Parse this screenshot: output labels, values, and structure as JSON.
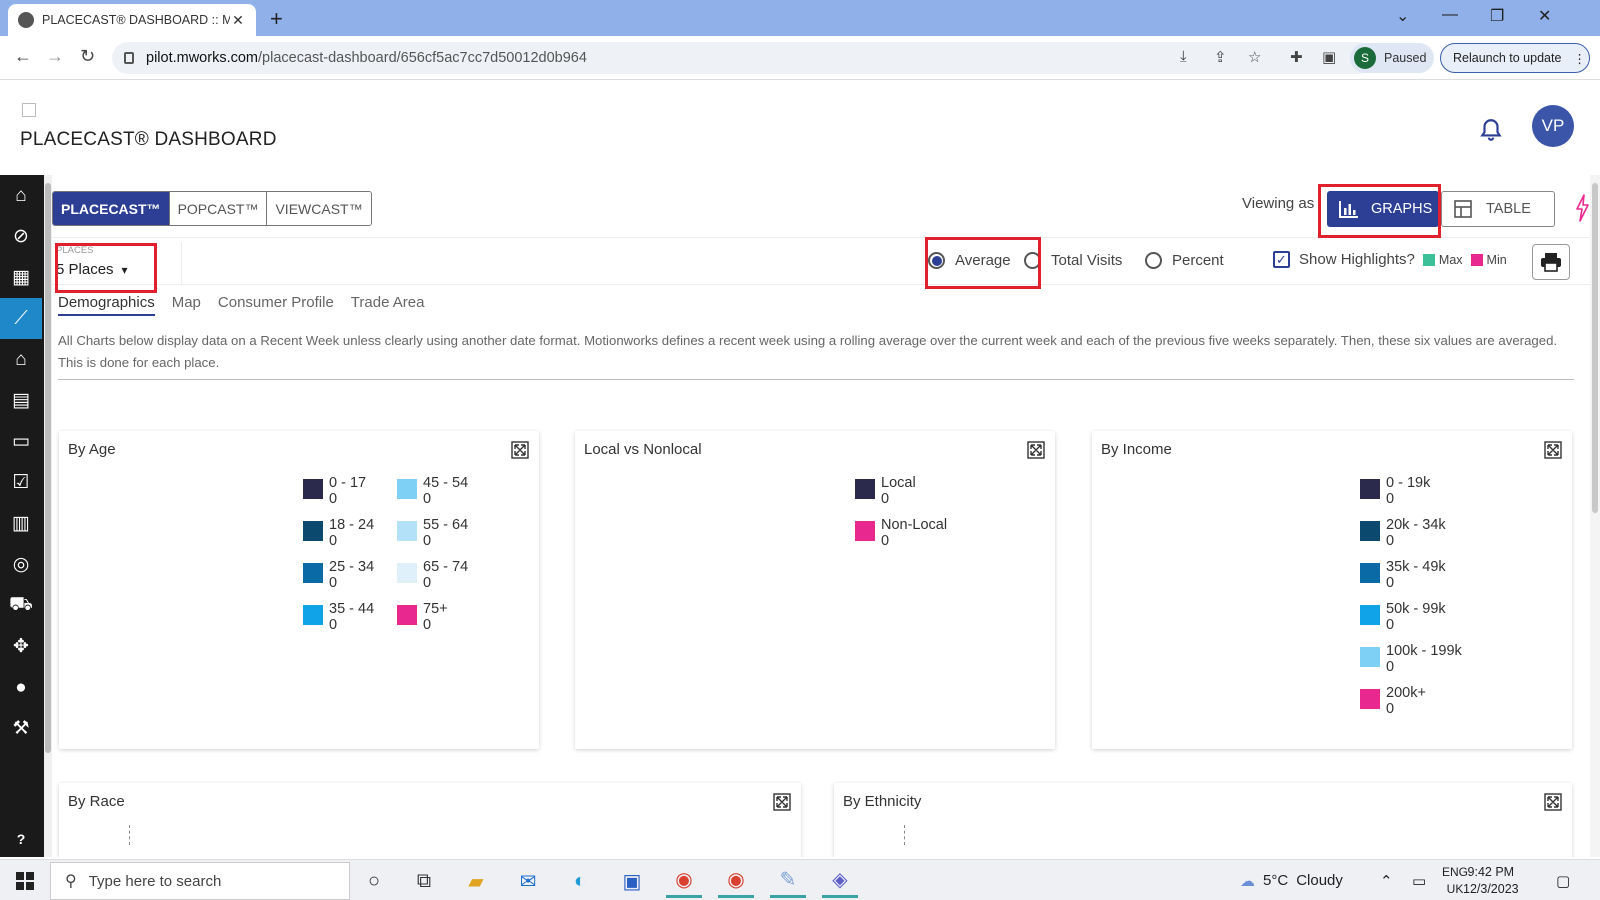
{
  "browser": {
    "tab_title": "PLACECAST® DASHBOARD :: M",
    "tab_close": "✕",
    "new_tab": "+",
    "url_domain": "pilot.mworks.com",
    "url_path": "/placecast-dashboard/656cf5ac7cc7d50012d0b964",
    "profile_initial": "S",
    "profile_status": "Paused",
    "relaunch_label": "Relaunch to update"
  },
  "header": {
    "title": "PLACECAST® DASHBOARD",
    "avatar_initials": "VP"
  },
  "product_tabs": [
    "PLACECAST™",
    "POPCAST™",
    "VIEWCAST™"
  ],
  "view_mode": {
    "viewing_label": "Viewing as",
    "graphs_label": "GRAPHS",
    "table_label": "TABLE"
  },
  "filters": {
    "places_label": "PLACES",
    "places_value": "5 Places",
    "metric_options": [
      "Average",
      "Total Visits",
      "Percent"
    ],
    "selected_metric": "Average",
    "highlights_label": "Show Highlights?",
    "highlights_checked": true,
    "max_label": "Max",
    "min_label": "Min",
    "max_color": "#3cc09a",
    "min_color": "#e8288f"
  },
  "subtabs": [
    "Demographics",
    "Map",
    "Consumer Profile",
    "Trade Area"
  ],
  "notice": "All Charts below display data on a Recent Week unless clearly using another date format. Motionworks defines a recent week using a rolling average over the current week and each of the previous five weeks separately. Then, these six values are averaged. This is done for each place.",
  "cards": {
    "age": {
      "title": "By Age",
      "legend": [
        {
          "label": "0 - 17",
          "value": "0",
          "color": "#2b2a4c"
        },
        {
          "label": "18 - 24",
          "value": "0",
          "color": "#0b4a6e"
        },
        {
          "label": "25 - 34",
          "value": "0",
          "color": "#0a6aa6"
        },
        {
          "label": "35 - 44",
          "value": "0",
          "color": "#10a3e8"
        },
        {
          "label": "45 - 54",
          "value": "0",
          "color": "#7fd0f5"
        },
        {
          "label": "55 - 64",
          "value": "0",
          "color": "#b3e1f7"
        },
        {
          "label": "65 - 74",
          "value": "0",
          "color": "#e0f0fb"
        },
        {
          "label": "75+",
          "value": "0",
          "color": "#e8288f"
        }
      ]
    },
    "local": {
      "title": "Local vs Nonlocal",
      "legend": [
        {
          "label": "Local",
          "value": "0",
          "color": "#2b2a4c"
        },
        {
          "label": "Non-Local",
          "value": "0",
          "color": "#e8288f"
        }
      ]
    },
    "income": {
      "title": "By Income",
      "legend": [
        {
          "label": "0 - 19k",
          "value": "0",
          "color": "#2b2a4c"
        },
        {
          "label": "20k - 34k",
          "value": "0",
          "color": "#0b4a6e"
        },
        {
          "label": "35k - 49k",
          "value": "0",
          "color": "#0a6aa6"
        },
        {
          "label": "50k - 99k",
          "value": "0",
          "color": "#10a3e8"
        },
        {
          "label": "100k - 199k",
          "value": "0",
          "color": "#7fd0f5"
        },
        {
          "label": "200k+",
          "value": "0",
          "color": "#e8288f"
        }
      ]
    },
    "race": {
      "title": "By Race"
    },
    "ethnicity": {
      "title": "By Ethnicity"
    }
  },
  "taskbar": {
    "search_placeholder": "Type here to search",
    "weather_temp": "5°C",
    "weather_text": "Cloudy",
    "lang_top": "ENG",
    "lang_bottom": "UK",
    "time": "9:42 PM",
    "date": "12/3/2023"
  }
}
